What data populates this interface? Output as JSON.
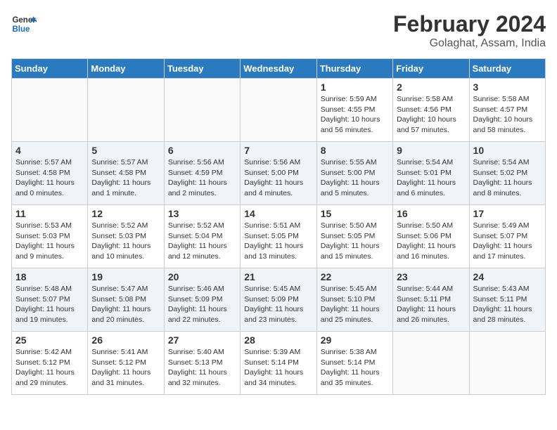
{
  "logo": {
    "text_general": "General",
    "text_blue": "Blue"
  },
  "header": {
    "title": "February 2024",
    "subtitle": "Golaghat, Assam, India"
  },
  "columns": [
    "Sunday",
    "Monday",
    "Tuesday",
    "Wednesday",
    "Thursday",
    "Friday",
    "Saturday"
  ],
  "weeks": [
    {
      "days": [
        {
          "num": "",
          "info": "",
          "empty": true
        },
        {
          "num": "",
          "info": "",
          "empty": true
        },
        {
          "num": "",
          "info": "",
          "empty": true
        },
        {
          "num": "",
          "info": "",
          "empty": true
        },
        {
          "num": "1",
          "info": "Sunrise: 5:59 AM\nSunset: 4:55 PM\nDaylight: 10 hours\nand 56 minutes."
        },
        {
          "num": "2",
          "info": "Sunrise: 5:58 AM\nSunset: 4:56 PM\nDaylight: 10 hours\nand 57 minutes."
        },
        {
          "num": "3",
          "info": "Sunrise: 5:58 AM\nSunset: 4:57 PM\nDaylight: 10 hours\nand 58 minutes."
        }
      ]
    },
    {
      "shade": true,
      "days": [
        {
          "num": "4",
          "info": "Sunrise: 5:57 AM\nSunset: 4:58 PM\nDaylight: 11 hours\nand 0 minutes."
        },
        {
          "num": "5",
          "info": "Sunrise: 5:57 AM\nSunset: 4:58 PM\nDaylight: 11 hours\nand 1 minute."
        },
        {
          "num": "6",
          "info": "Sunrise: 5:56 AM\nSunset: 4:59 PM\nDaylight: 11 hours\nand 2 minutes."
        },
        {
          "num": "7",
          "info": "Sunrise: 5:56 AM\nSunset: 5:00 PM\nDaylight: 11 hours\nand 4 minutes."
        },
        {
          "num": "8",
          "info": "Sunrise: 5:55 AM\nSunset: 5:00 PM\nDaylight: 11 hours\nand 5 minutes."
        },
        {
          "num": "9",
          "info": "Sunrise: 5:54 AM\nSunset: 5:01 PM\nDaylight: 11 hours\nand 6 minutes."
        },
        {
          "num": "10",
          "info": "Sunrise: 5:54 AM\nSunset: 5:02 PM\nDaylight: 11 hours\nand 8 minutes."
        }
      ]
    },
    {
      "days": [
        {
          "num": "11",
          "info": "Sunrise: 5:53 AM\nSunset: 5:03 PM\nDaylight: 11 hours\nand 9 minutes."
        },
        {
          "num": "12",
          "info": "Sunrise: 5:52 AM\nSunset: 5:03 PM\nDaylight: 11 hours\nand 10 minutes."
        },
        {
          "num": "13",
          "info": "Sunrise: 5:52 AM\nSunset: 5:04 PM\nDaylight: 11 hours\nand 12 minutes."
        },
        {
          "num": "14",
          "info": "Sunrise: 5:51 AM\nSunset: 5:05 PM\nDaylight: 11 hours\nand 13 minutes."
        },
        {
          "num": "15",
          "info": "Sunrise: 5:50 AM\nSunset: 5:05 PM\nDaylight: 11 hours\nand 15 minutes."
        },
        {
          "num": "16",
          "info": "Sunrise: 5:50 AM\nSunset: 5:06 PM\nDaylight: 11 hours\nand 16 minutes."
        },
        {
          "num": "17",
          "info": "Sunrise: 5:49 AM\nSunset: 5:07 PM\nDaylight: 11 hours\nand 17 minutes."
        }
      ]
    },
    {
      "shade": true,
      "days": [
        {
          "num": "18",
          "info": "Sunrise: 5:48 AM\nSunset: 5:07 PM\nDaylight: 11 hours\nand 19 minutes."
        },
        {
          "num": "19",
          "info": "Sunrise: 5:47 AM\nSunset: 5:08 PM\nDaylight: 11 hours\nand 20 minutes."
        },
        {
          "num": "20",
          "info": "Sunrise: 5:46 AM\nSunset: 5:09 PM\nDaylight: 11 hours\nand 22 minutes."
        },
        {
          "num": "21",
          "info": "Sunrise: 5:45 AM\nSunset: 5:09 PM\nDaylight: 11 hours\nand 23 minutes."
        },
        {
          "num": "22",
          "info": "Sunrise: 5:45 AM\nSunset: 5:10 PM\nDaylight: 11 hours\nand 25 minutes."
        },
        {
          "num": "23",
          "info": "Sunrise: 5:44 AM\nSunset: 5:11 PM\nDaylight: 11 hours\nand 26 minutes."
        },
        {
          "num": "24",
          "info": "Sunrise: 5:43 AM\nSunset: 5:11 PM\nDaylight: 11 hours\nand 28 minutes."
        }
      ]
    },
    {
      "days": [
        {
          "num": "25",
          "info": "Sunrise: 5:42 AM\nSunset: 5:12 PM\nDaylight: 11 hours\nand 29 minutes."
        },
        {
          "num": "26",
          "info": "Sunrise: 5:41 AM\nSunset: 5:12 PM\nDaylight: 11 hours\nand 31 minutes."
        },
        {
          "num": "27",
          "info": "Sunrise: 5:40 AM\nSunset: 5:13 PM\nDaylight: 11 hours\nand 32 minutes."
        },
        {
          "num": "28",
          "info": "Sunrise: 5:39 AM\nSunset: 5:14 PM\nDaylight: 11 hours\nand 34 minutes."
        },
        {
          "num": "29",
          "info": "Sunrise: 5:38 AM\nSunset: 5:14 PM\nDaylight: 11 hours\nand 35 minutes."
        },
        {
          "num": "",
          "info": "",
          "empty": true
        },
        {
          "num": "",
          "info": "",
          "empty": true
        }
      ]
    }
  ]
}
